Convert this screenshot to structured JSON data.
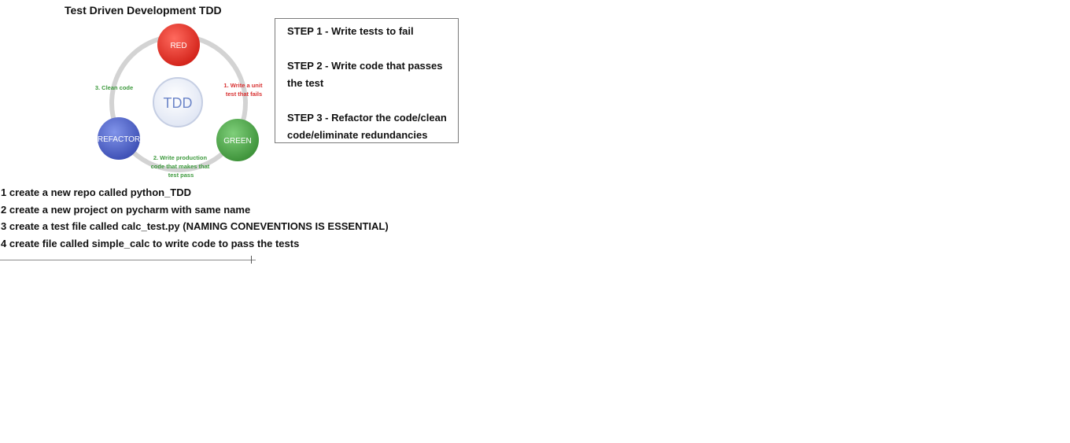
{
  "title": "Test Driven Development TDD",
  "diagram": {
    "center_label": "TDD",
    "nodes": {
      "red": "RED",
      "green": "GREEN",
      "refactor": "REFACTOR"
    },
    "arrows": {
      "red_to_green": [
        "1. Write a unit",
        "test that fails"
      ],
      "green_to_refactor": [
        "2. Write production",
        "code that makes that",
        "test pass"
      ],
      "refactor_to_red": "3. Clean code"
    },
    "colors": {
      "red": "#e8322a",
      "green": "#4aa64a",
      "refactor": "#4b5fc4",
      "ring": "#d3d3d3",
      "center": "#eef2fa",
      "label_red": "#d83030",
      "label_green": "#3e9a3e"
    }
  },
  "steps": [
    "STEP 1 - Write tests to fail",
    "STEP 2 - Write code that passes the test",
    "STEP 3 - Refactor the code/clean code/eliminate redundancies"
  ],
  "instructions": [
    "1 create a new repo called python_TDD",
    "2 create a new project on pycharm with same name",
    "3 create a test file called calc_test.py (NAMING CONEVENTIONS IS ESSENTIAL)",
    "4 create file called simple_calc to write code to pass the tests"
  ]
}
